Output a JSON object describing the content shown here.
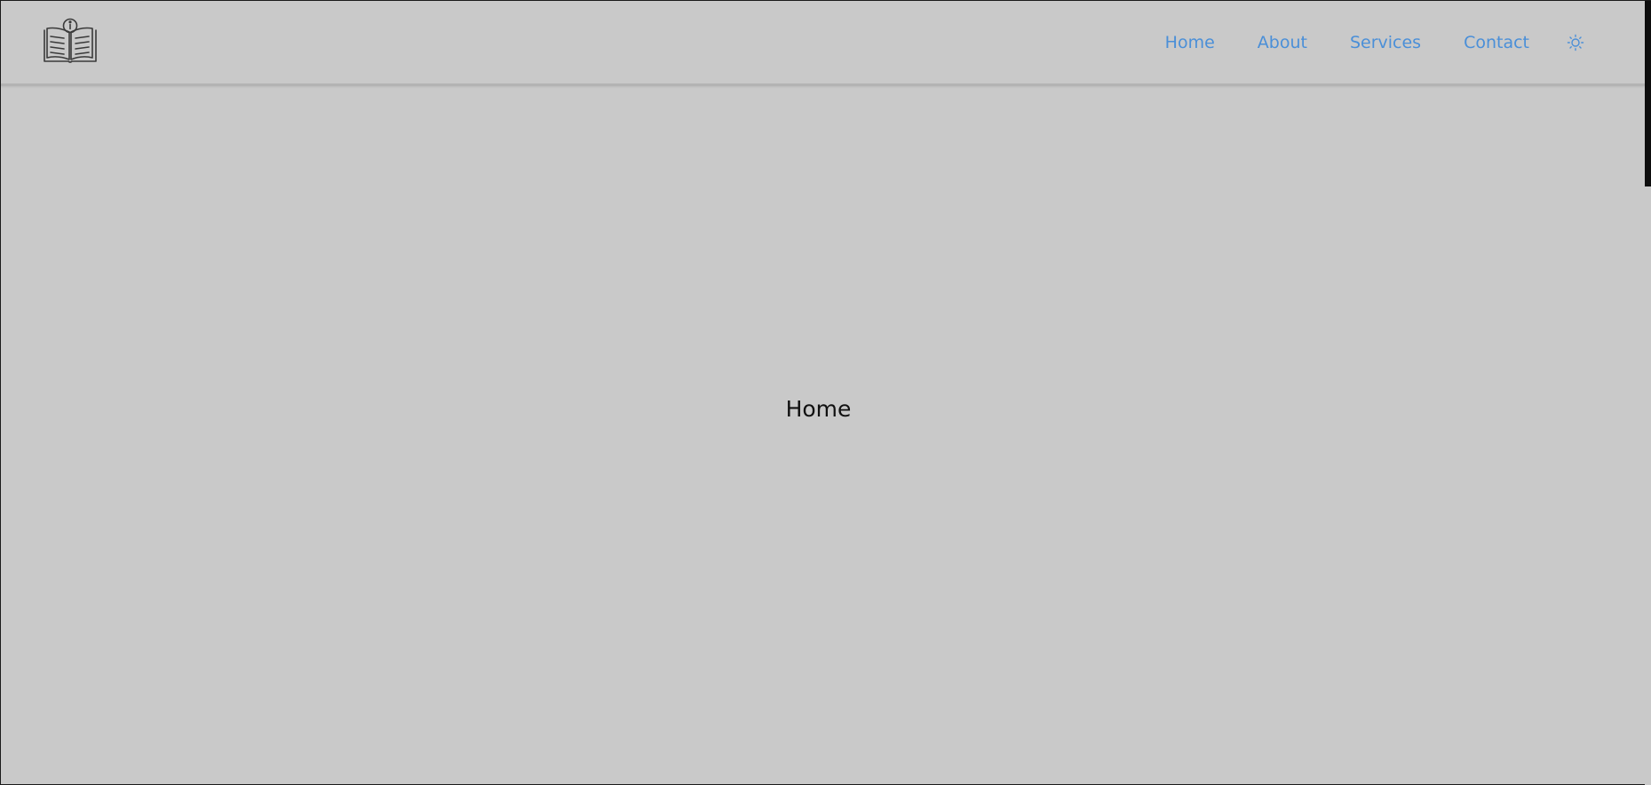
{
  "navbar": {
    "logo_icon": "open-book-info-icon",
    "links": [
      {
        "label": "Home"
      },
      {
        "label": "About"
      },
      {
        "label": "Services"
      },
      {
        "label": "Contact"
      }
    ],
    "theme_toggle_icon": "sun-icon"
  },
  "main": {
    "title": "Home"
  },
  "colors": {
    "background": "#c9c9c9",
    "link": "#4a8fd8",
    "text": "#111111",
    "border": "#b3b3b3"
  }
}
